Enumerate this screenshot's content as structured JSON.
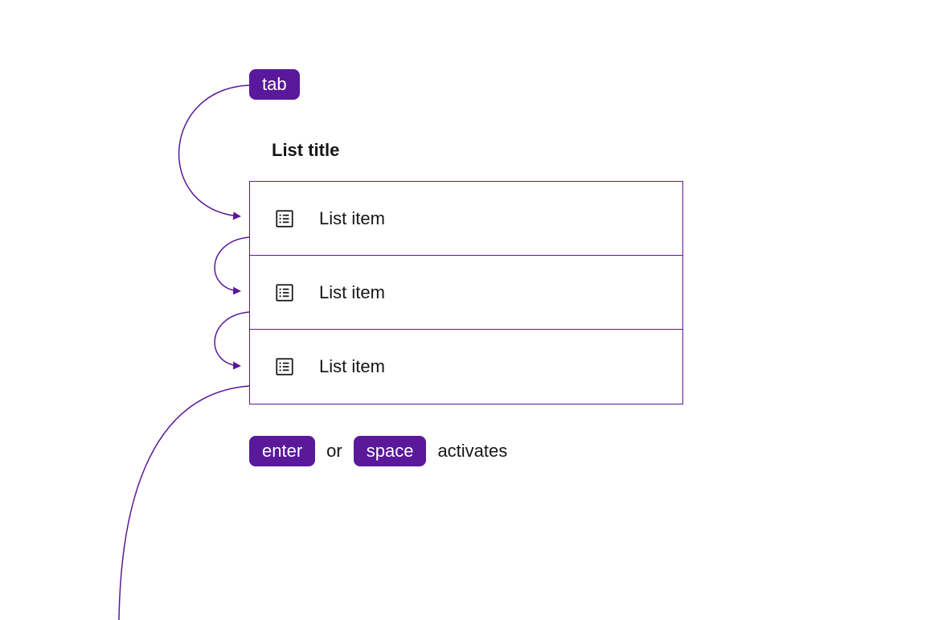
{
  "keys": {
    "tab": "tab",
    "enter": "enter",
    "space": "space"
  },
  "list": {
    "title": "List title",
    "items": [
      {
        "label": "List item"
      },
      {
        "label": "List item"
      },
      {
        "label": "List item"
      }
    ]
  },
  "footer": {
    "or": "or",
    "activates": "activates"
  },
  "colors": {
    "accent": "#5a189a",
    "text": "#161616"
  }
}
